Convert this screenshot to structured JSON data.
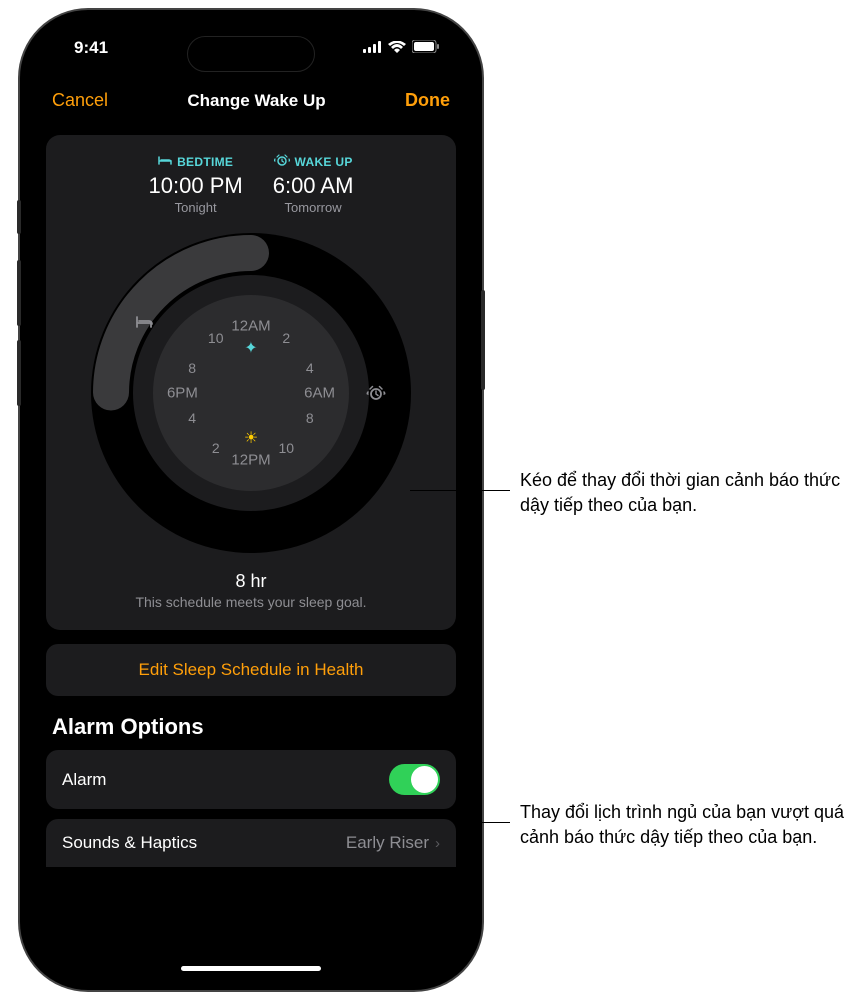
{
  "status": {
    "time": "9:41"
  },
  "header": {
    "cancel": "Cancel",
    "title": "Change Wake Up",
    "done": "Done"
  },
  "schedule": {
    "bedtime": {
      "label": "BEDTIME",
      "time": "10:00 PM",
      "sub": "Tonight"
    },
    "wakeup": {
      "label": "WAKE UP",
      "time": "6:00 AM",
      "sub": "Tomorrow"
    }
  },
  "dial": {
    "labels": {
      "t12am": "12AM",
      "t2": "2",
      "t4": "4",
      "t6am": "6AM",
      "t8": "8",
      "t10": "10",
      "t12pm": "12PM",
      "t2p": "2",
      "t4p": "4",
      "t6pm": "6PM",
      "t8p": "8",
      "t10p": "10"
    }
  },
  "goal": {
    "duration": "8 hr",
    "note": "This schedule meets your sleep goal."
  },
  "editButton": "Edit Sleep Schedule in Health",
  "alarmOptions": {
    "title": "Alarm Options",
    "alarm_label": "Alarm",
    "sounds_label": "Sounds & Haptics",
    "sounds_value": "Early Riser"
  },
  "callouts": {
    "c1": "Kéo để thay đổi thời gian cảnh báo thức dậy tiếp theo của bạn.",
    "c2": "Thay đổi lịch trình ngủ của bạn vượt quá cảnh báo thức dậy tiếp theo của bạn."
  }
}
